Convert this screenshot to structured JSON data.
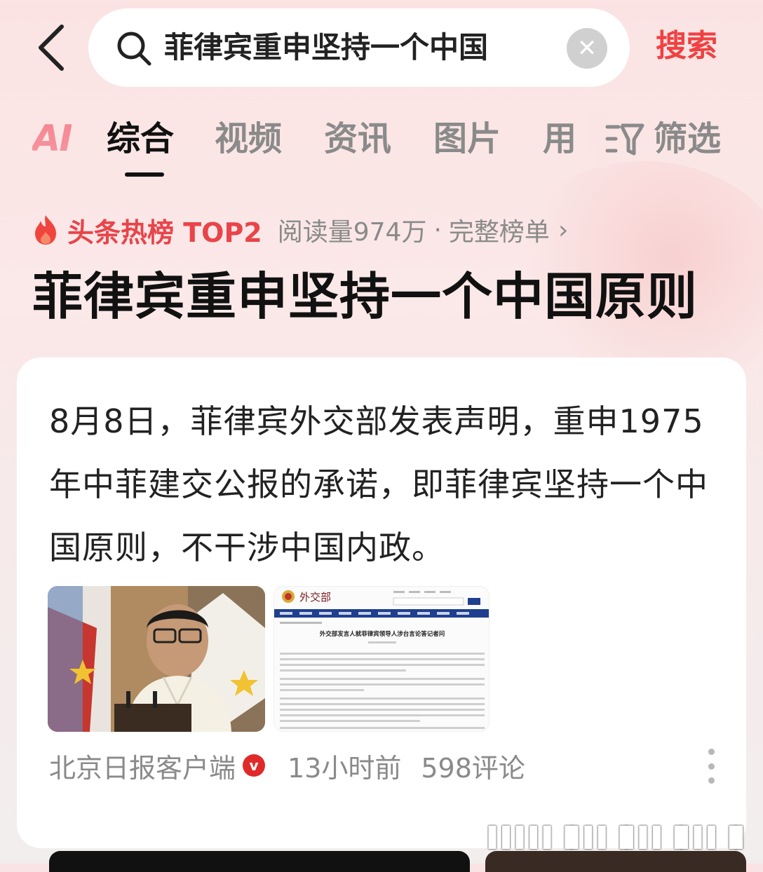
{
  "search": {
    "query": "菲律宾重申坚持一个中国",
    "submit_label": "搜索"
  },
  "tabs": [
    {
      "label": "AI"
    },
    {
      "label": "综合",
      "active": true
    },
    {
      "label": "视频"
    },
    {
      "label": "资讯"
    },
    {
      "label": "图片"
    },
    {
      "label": "用"
    }
  ],
  "filter_label": "筛选",
  "hot": {
    "label": "头条热榜 TOP2",
    "reads": "阅读量974万",
    "separator": "·",
    "full_list": "完整榜单",
    "chevron": "›"
  },
  "topic_title": "菲律宾重申坚持一个中国原则",
  "card": {
    "text": "8月8日，菲律宾外交部发表声明，重申1975年中菲建交公报的承诺，即菲律宾坚持一个中国原则，不干涉中国内政。",
    "source": "北京日报客户端",
    "verified": "v",
    "time": "13小时前",
    "comments": "598评论"
  },
  "doc_thumb": {
    "logo": "外交部",
    "headline": "外交部发言人就菲律宾领导人涉台言论答记者问"
  },
  "colors": {
    "accent": "#f04142",
    "hot": "#e8444a"
  }
}
